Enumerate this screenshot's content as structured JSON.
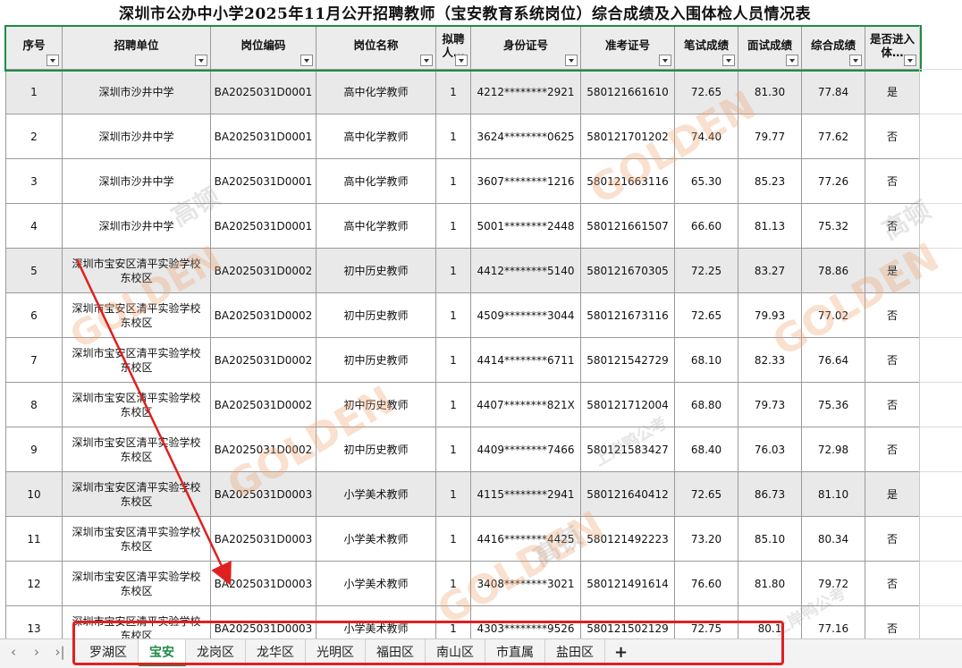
{
  "title": "深圳市公办中小学2025年11月公开招聘教师（宝安教育系统岗位）综合成绩及入围体检人员情况表",
  "headers": [
    "序号",
    "招聘单位",
    "岗位编码",
    "岗位名称",
    "拟聘人数",
    "身份证号",
    "准考证号",
    "笔试成绩",
    "面试成绩",
    "综合成绩",
    "是否进入体检"
  ],
  "header_display": [
    "序号",
    "招聘单位",
    "岗位编码",
    "岗位名称",
    "拟聘人…",
    "身份证号",
    "准考证号",
    "笔试成绩",
    "面试成绩",
    "综合成绩",
    "是否进入体…"
  ],
  "rows": [
    {
      "no": "1",
      "unit": "深圳市沙井中学",
      "code": "BA2025031D0001",
      "post": "高中化学教师",
      "num": "1",
      "id": "4212********2921",
      "ticket": "580121661610",
      "written": "72.65",
      "interview": "81.30",
      "total": "77.84",
      "pass": "是",
      "shade": true
    },
    {
      "no": "2",
      "unit": "深圳市沙井中学",
      "code": "BA2025031D0001",
      "post": "高中化学教师",
      "num": "1",
      "id": "3624********0625",
      "ticket": "580121701202",
      "written": "74.40",
      "interview": "79.77",
      "total": "77.62",
      "pass": "否",
      "shade": false
    },
    {
      "no": "3",
      "unit": "深圳市沙井中学",
      "code": "BA2025031D0001",
      "post": "高中化学教师",
      "num": "1",
      "id": "3607********1216",
      "ticket": "580121663116",
      "written": "65.30",
      "interview": "85.23",
      "total": "77.26",
      "pass": "否",
      "shade": false
    },
    {
      "no": "4",
      "unit": "深圳市沙井中学",
      "code": "BA2025031D0001",
      "post": "高中化学教师",
      "num": "1",
      "id": "5001********2448",
      "ticket": "580121661507",
      "written": "66.60",
      "interview": "81.13",
      "total": "75.32",
      "pass": "否",
      "shade": false
    },
    {
      "no": "5",
      "unit": "深圳市宝安区清平实验学校东校区",
      "code": "BA2025031D0002",
      "post": "初中历史教师",
      "num": "1",
      "id": "4412********5140",
      "ticket": "580121670305",
      "written": "72.25",
      "interview": "83.27",
      "total": "78.86",
      "pass": "是",
      "shade": true
    },
    {
      "no": "6",
      "unit": "深圳市宝安区清平实验学校东校区",
      "code": "BA2025031D0002",
      "post": "初中历史教师",
      "num": "1",
      "id": "4509********3044",
      "ticket": "580121673116",
      "written": "72.65",
      "interview": "79.93",
      "total": "77.02",
      "pass": "否",
      "shade": false
    },
    {
      "no": "7",
      "unit": "深圳市宝安区清平实验学校东校区",
      "code": "BA2025031D0002",
      "post": "初中历史教师",
      "num": "1",
      "id": "4414********6711",
      "ticket": "580121542729",
      "written": "68.10",
      "interview": "82.33",
      "total": "76.64",
      "pass": "否",
      "shade": false
    },
    {
      "no": "8",
      "unit": "深圳市宝安区清平实验学校东校区",
      "code": "BA2025031D0002",
      "post": "初中历史教师",
      "num": "1",
      "id": "4407********821X",
      "ticket": "580121712004",
      "written": "68.80",
      "interview": "79.73",
      "total": "75.36",
      "pass": "否",
      "shade": false
    },
    {
      "no": "9",
      "unit": "深圳市宝安区清平实验学校东校区",
      "code": "BA2025031D0002",
      "post": "初中历史教师",
      "num": "1",
      "id": "4409********7466",
      "ticket": "580121583427",
      "written": "68.40",
      "interview": "76.03",
      "total": "72.98",
      "pass": "否",
      "shade": false
    },
    {
      "no": "10",
      "unit": "深圳市宝安区清平实验学校东校区",
      "code": "BA2025031D0003",
      "post": "小学美术教师",
      "num": "1",
      "id": "4115********2941",
      "ticket": "580121640412",
      "written": "72.65",
      "interview": "86.73",
      "total": "81.10",
      "pass": "是",
      "shade": true
    },
    {
      "no": "11",
      "unit": "深圳市宝安区清平实验学校东校区",
      "code": "BA2025031D0003",
      "post": "小学美术教师",
      "num": "1",
      "id": "4416********4425",
      "ticket": "580121492223",
      "written": "73.20",
      "interview": "85.10",
      "total": "80.34",
      "pass": "否",
      "shade": false
    },
    {
      "no": "12",
      "unit": "深圳市宝安区清平实验学校东校区",
      "code": "BA2025031D0003",
      "post": "小学美术教师",
      "num": "1",
      "id": "3408********3021",
      "ticket": "580121491614",
      "written": "76.60",
      "interview": "81.80",
      "total": "79.72",
      "pass": "否",
      "shade": false
    },
    {
      "no": "13",
      "unit": "深圳市宝安区清平实验学校东校区",
      "code": "BA2025031D0003",
      "post": "小学美术教师",
      "num": "1",
      "id": "4303********9526",
      "ticket": "580121502129",
      "written": "72.75",
      "interview": "80.1",
      "total": "77.16",
      "pass": "否",
      "shade": false
    }
  ],
  "tabs": [
    "罗湖区",
    "宝安",
    "龙岗区",
    "龙华区",
    "光明区",
    "福田区",
    "南山区",
    "市直属",
    "盐田区"
  ],
  "active_tab": "宝安",
  "add_tab": "+",
  "nav": {
    "prev": "‹",
    "next": "›",
    "last": "›|"
  },
  "watermark": {
    "brand": "GOLDEN",
    "cn": "高顿",
    "partner": "上岸鸭公考"
  },
  "colors": {
    "accent": "#1e8c47",
    "annotation": "#e02020",
    "shade": "#e9e9e9"
  }
}
